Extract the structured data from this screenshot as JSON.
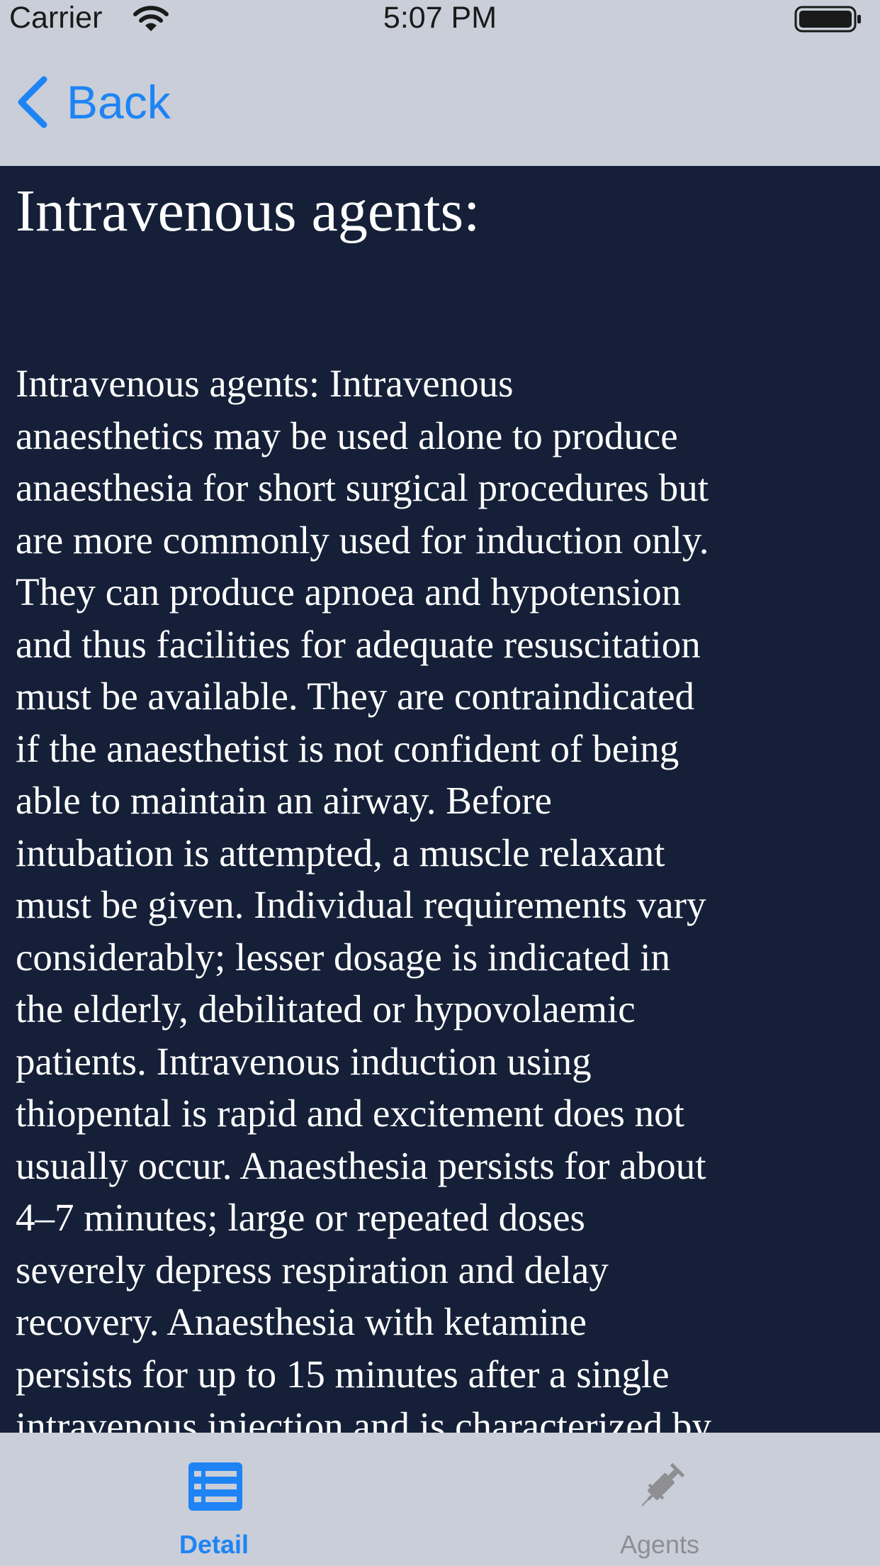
{
  "status_bar": {
    "carrier": "Carrier",
    "time": "5:07 PM",
    "icons": [
      "wifi-icon",
      "battery-icon"
    ]
  },
  "nav_bar": {
    "back_label": "Back",
    "back_icon": "chevron-left-icon"
  },
  "content": {
    "title": "Intravenous agents:",
    "body": "Intravenous agents:  Intravenous\nanaesthetics may be used alone to produce\nanaesthesia for short surgical procedures but\nare more commonly used for induction only.\nThey can produce apnoea and hypotension\nand thus facilities for adequate resuscitation\nmust be available. They are contraindicated\nif the anaesthetist is not confident of being\nable to maintain an airway. Before\nintubation is attempted, a muscle relaxant\nmust be given. Individual requirements vary\nconsiderably; lesser dosage is indicated in\nthe elderly, debilitated or hypovolaemic\npatients. Intravenous induction using\nthiopental is rapid and excitement does not\nusually occur. Anaesthesia persists for about\n4–7 minutes; large or repeated doses\nseverely depress respiration and delay\nrecovery. Anaesthesia with ketamine\npersists for up to 15 minutes after a single\nintravenous injection and is characterized by"
  },
  "tab_bar": {
    "tabs": [
      {
        "label": "Detail",
        "icon": "list-icon",
        "selected": true
      },
      {
        "label": "Agents",
        "icon": "syringe-icon",
        "selected": false
      }
    ]
  },
  "colors": {
    "bar_background": "#c9ced8",
    "content_background": "#152038",
    "accent": "#1e84f5",
    "inactive": "#8e8e93",
    "text": "#ffffff"
  }
}
